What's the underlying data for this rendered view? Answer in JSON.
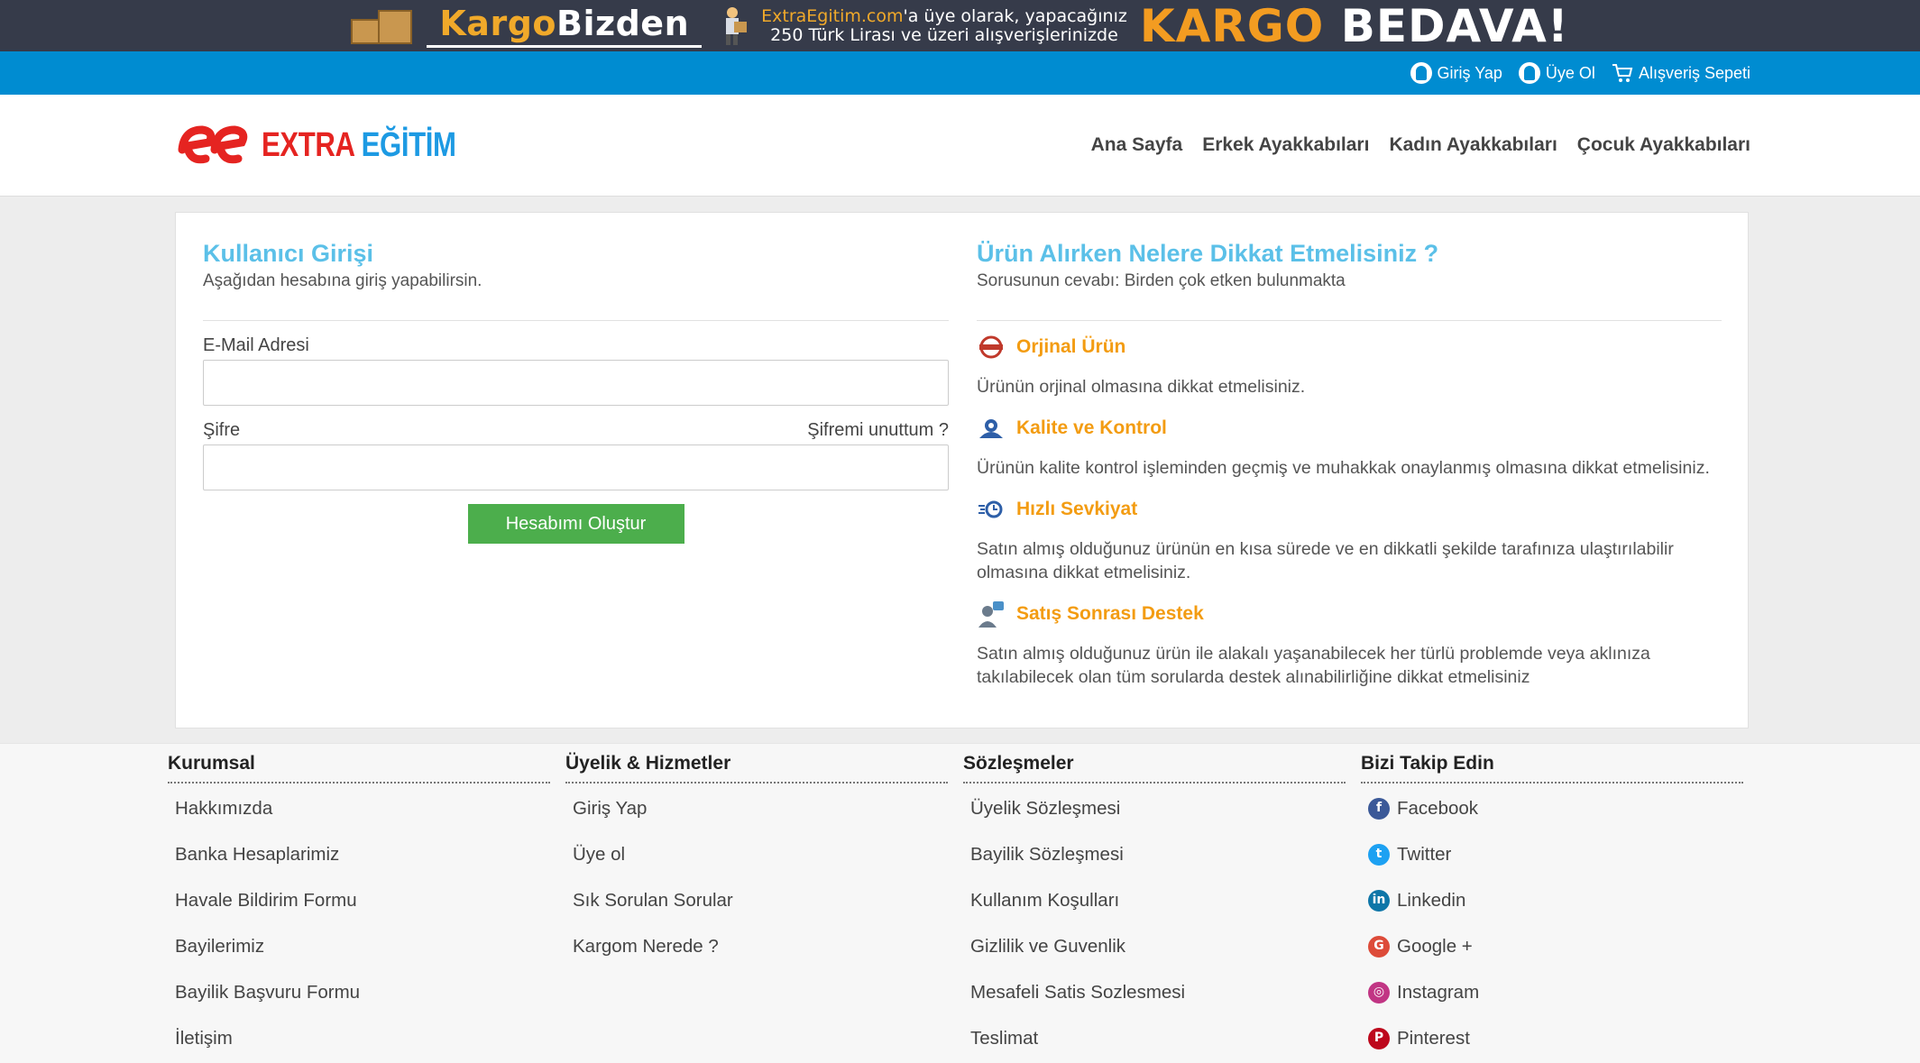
{
  "banner": {
    "logo_part1": "Kargo",
    "logo_part2": "Bizden",
    "promo_site": "ExtraEgitim.com",
    "promo_line1_rest": "'a üye olarak, yapacağınız",
    "promo_line2": "250 Türk Lirası ve üzeri alışverişlerinizde",
    "free_part1": "KARGO",
    "free_part2": "BEDAVA!"
  },
  "topbar": {
    "login": "Giriş Yap",
    "register": "Üye Ol",
    "cart": "Alışveriş Sepeti"
  },
  "header": {
    "logo_part1": "EXTRA",
    "logo_part2": "EĞİTİM",
    "nav": [
      "Ana Sayfa",
      "Erkek Ayakkabıları",
      "Kadın Ayakkabıları",
      "Çocuk Ayakkabıları"
    ]
  },
  "login": {
    "title": "Kullanıcı Girişi",
    "subtitle": "Aşağıdan hesabına giriş yapabilirsin.",
    "email_label": "E-Mail Adresi",
    "email_value": "",
    "password_label": "Şifre",
    "password_value": "",
    "forgot": "Şifremi unuttum ?",
    "submit": "Hesabımı Oluştur"
  },
  "tips": {
    "title": "Ürün Alırken Nelere Dikkat Etmelisiniz ?",
    "subtitle": "Sorusunun cevabı: Birden çok etken bulunmakta",
    "items": [
      {
        "title": "Orjinal Ürün",
        "text": "Ürünün orjinal olmasına dikkat etmelisiniz.",
        "icon": "original-badge-icon"
      },
      {
        "title": "Kalite ve Kontrol",
        "text": "Ürünün kalite kontrol işleminden geçmiş ve muhakkak onaylanmış olmasına dikkat etmelisiniz.",
        "icon": "quality-icon"
      },
      {
        "title": "Hızlı Sevkiyat",
        "text": "Satın almış olduğunuz ürünün en kısa sürede ve en dikkatli şekilde tarafınıza ulaştırılabilir olmasına dikkat etmelisiniz.",
        "icon": "fast-shipping-icon"
      },
      {
        "title": "Satış Sonrası Destek",
        "text": "Satın almış olduğunuz ürün ile alakalı yaşanabilecek her türlü problemde veya aklınıza takılabilecek olan tüm sorularda destek alınabilirliğine dikkat etmelisiniz",
        "icon": "support-icon"
      }
    ]
  },
  "footer": {
    "columns": [
      {
        "title": "Kurumsal",
        "items": [
          "Hakkımızda",
          "Banka Hesaplarimiz",
          "Havale Bildirim Formu",
          "Bayilerimiz",
          "Bayilik Başvuru Formu",
          "İletişim"
        ]
      },
      {
        "title": "Üyelik & Hizmetler",
        "items": [
          "Giriş Yap",
          "Üye ol",
          "Sık Sorulan Sorular",
          "Kargom Nerede ?"
        ]
      },
      {
        "title": "Sözleşmeler",
        "items": [
          "Üyelik Sözleşmesi",
          "Bayilik Sözleşmesi",
          "Kullanım Koşulları",
          "Gizlilik ve Guvenlik",
          "Mesafeli Satis Sozlesmesi",
          "Teslimat"
        ]
      },
      {
        "title": "Bizi Takip Edin",
        "items": [
          "Facebook",
          "Twitter",
          "Linkedin",
          "Google +",
          "Instagram",
          "Pinterest"
        ]
      }
    ]
  },
  "colors": {
    "accent_blue": "#008cd1",
    "title_blue": "#5bc0e8",
    "orange": "#f39c12",
    "green": "#4cae4c",
    "brand_red": "#e52421"
  }
}
